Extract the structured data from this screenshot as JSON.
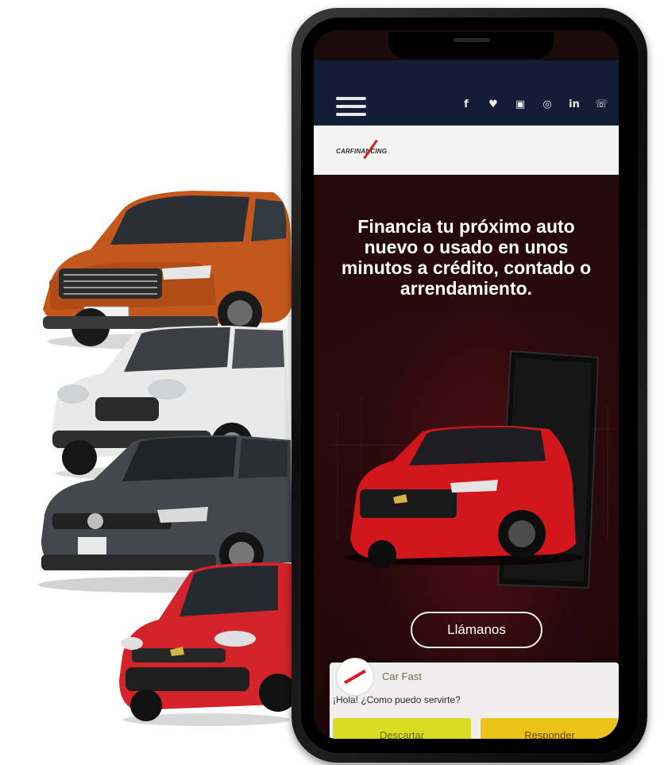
{
  "header": {
    "menu_icon": "hamburger-icon",
    "social_icons": [
      {
        "name": "facebook-icon",
        "glyph": "f"
      },
      {
        "name": "twitter-icon",
        "glyph": "♥"
      },
      {
        "name": "youtube-icon",
        "glyph": "▣"
      },
      {
        "name": "instagram-icon",
        "glyph": "◎"
      },
      {
        "name": "linkedin-icon",
        "glyph": "in"
      },
      {
        "name": "whatsapp-icon",
        "glyph": "☏"
      }
    ]
  },
  "brand": {
    "logo_text": "CARFINANCING"
  },
  "hero": {
    "title": "Financia tu próximo auto nuevo o usado en unos minutos a crédito, contado o arrendamiento.",
    "call_button": "Llámanos"
  },
  "chat": {
    "name": "Car Fast",
    "message": "¡Hola! ¿Como puedo servirte?",
    "dismiss_label": "Descartar",
    "reply_label": "Responder"
  },
  "colors": {
    "nav_bg": "#131e36",
    "hero_bg": "#22090c",
    "brand_red": "#d31e27",
    "dismiss_bg": "#d9dd22",
    "reply_bg": "#ecc319"
  },
  "cars": [
    "orange-suv",
    "white-mini-car",
    "gray-hatchback",
    "red-hatchback"
  ]
}
